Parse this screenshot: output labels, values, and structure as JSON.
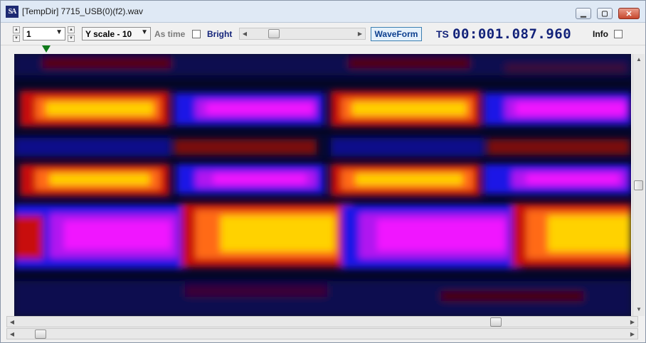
{
  "window": {
    "icon_text": "SA",
    "title": "[TempDir] 7715_USB(0)(f2).wav",
    "minimize_icon": "minimize-icon",
    "maximize_icon": "maximize-icon",
    "close_icon": "close-icon"
  },
  "toolbar": {
    "channel_value": "1",
    "yscale_value": "Y scale - 10",
    "as_time_label": "As time",
    "bright_label": "Bright",
    "waveform_label": "WaveForm",
    "ts_label": "TS",
    "ts_value": "00:001.087.960",
    "info_label": "Info",
    "bright_slider_position": 0.2
  },
  "spectrogram": {
    "colors": {
      "background": "#05082f",
      "blue": "#1a14e6",
      "magenta": "#f019ff",
      "red": "#c8100e",
      "orange": "#ff6a12",
      "yellow": "#ffd200"
    }
  },
  "scrollbars": {
    "inner_h_position": 0.79,
    "outer_h_position": 0.03,
    "v_position": 0.5
  }
}
